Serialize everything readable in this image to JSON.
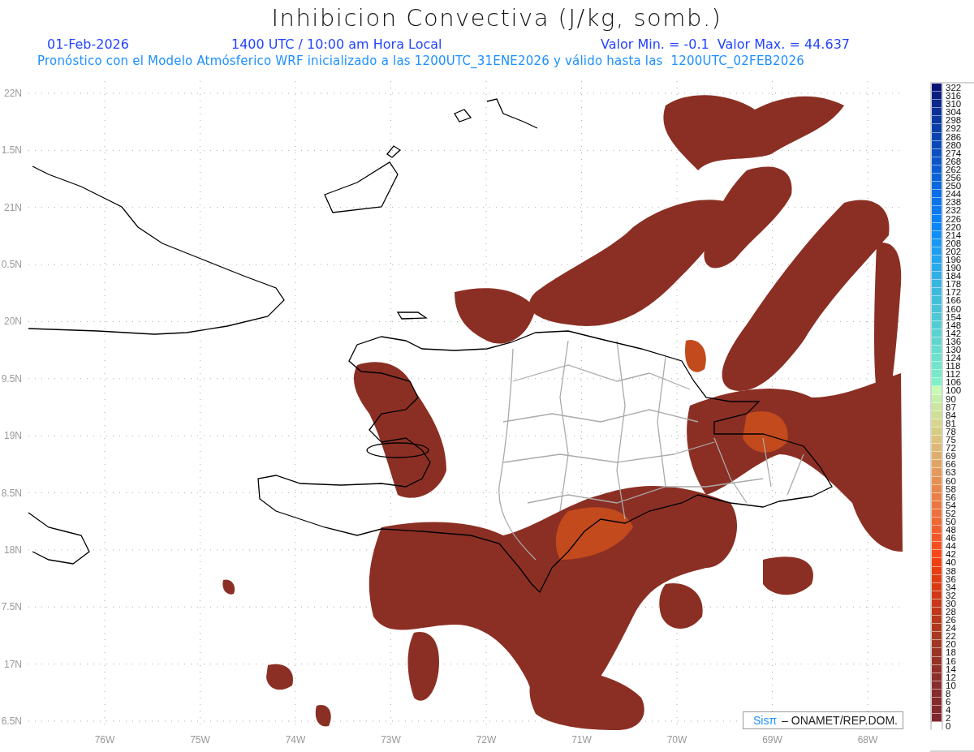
{
  "title": "Inhibicion Convectiva (J/kg, somb.)",
  "subtitle": {
    "date": "01-Feb-2026",
    "time": "1400 UTC / 10:00 am Hora Local",
    "range": "Valor Min. = -0.1  Valor Max. = 44.637"
  },
  "description": "Pronóstico con el Modelo Atmósferico WRF inicializado a las 1200UTC_31ENE2026 y válido hasta las  1200UTC_02FEB2026",
  "map": {
    "latitude_labels": [
      "22N",
      "1.5N",
      "21N",
      "0.5N",
      "20N",
      "9.5N",
      "19N",
      "8.5N",
      "18N",
      "7.5N",
      "17N",
      "6.5N"
    ],
    "longitude_labels": [
      "76W",
      "75W",
      "74W",
      "73W",
      "72W",
      "71W",
      "70W",
      "69W",
      "68W"
    ],
    "credit": {
      "brand": "Sisπ",
      "text": "– ONAMET/REP.DOM."
    }
  },
  "legend": {
    "levels": [
      {
        "label": "322",
        "color": "#0a1478"
      },
      {
        "label": "316",
        "color": "#0a1e82"
      },
      {
        "label": "310",
        "color": "#0a288c"
      },
      {
        "label": "304",
        "color": "#0a3096"
      },
      {
        "label": "298",
        "color": "#0a38a0"
      },
      {
        "label": "292",
        "color": "#0a3ea8"
      },
      {
        "label": "286",
        "color": "#0a44b0"
      },
      {
        "label": "280",
        "color": "#0a4ab8"
      },
      {
        "label": "274",
        "color": "#0a50c0"
      },
      {
        "label": "268",
        "color": "#0a56c8"
      },
      {
        "label": "262",
        "color": "#0a5cd0"
      },
      {
        "label": "256",
        "color": "#0a62d8"
      },
      {
        "label": "250",
        "color": "#0a68e0"
      },
      {
        "label": "244",
        "color": "#0a6ee6"
      },
      {
        "label": "238",
        "color": "#0a74ec"
      },
      {
        "label": "232",
        "color": "#0a7af0"
      },
      {
        "label": "226",
        "color": "#0a80f4"
      },
      {
        "label": "220",
        "color": "#0a86f6"
      },
      {
        "label": "214",
        "color": "#1090f6"
      },
      {
        "label": "208",
        "color": "#1898f2"
      },
      {
        "label": "202",
        "color": "#1e9ef0"
      },
      {
        "label": "196",
        "color": "#24a4ec"
      },
      {
        "label": "190",
        "color": "#2aaaea"
      },
      {
        "label": "184",
        "color": "#30b0e6"
      },
      {
        "label": "178",
        "color": "#36b6e2"
      },
      {
        "label": "172",
        "color": "#3cbade"
      },
      {
        "label": "166",
        "color": "#42c0da"
      },
      {
        "label": "160",
        "color": "#48c4d8"
      },
      {
        "label": "154",
        "color": "#4ec8d6"
      },
      {
        "label": "148",
        "color": "#54ccd4"
      },
      {
        "label": "142",
        "color": "#5ad2d2"
      },
      {
        "label": "136",
        "color": "#60d6d0"
      },
      {
        "label": "130",
        "color": "#66dcce"
      },
      {
        "label": "124",
        "color": "#6ce2cc"
      },
      {
        "label": "118",
        "color": "#72e6ca"
      },
      {
        "label": "112",
        "color": "#78eac8"
      },
      {
        "label": "106",
        "color": "#7ef0c8"
      },
      {
        "label": "100",
        "color": "#c8fab4"
      },
      {
        "label": "90",
        "color": "#c4f0a8"
      },
      {
        "label": "87",
        "color": "#cce6a0"
      },
      {
        "label": "84",
        "color": "#d0de96"
      },
      {
        "label": "81",
        "color": "#d6d68e"
      },
      {
        "label": "78",
        "color": "#d8cc84"
      },
      {
        "label": "75",
        "color": "#dcc27c"
      },
      {
        "label": "72",
        "color": "#deb874"
      },
      {
        "label": "69",
        "color": "#e0ae6c"
      },
      {
        "label": "66",
        "color": "#e2a464"
      },
      {
        "label": "63",
        "color": "#e49a5c"
      },
      {
        "label": "60",
        "color": "#e69052"
      },
      {
        "label": "58",
        "color": "#e8884c"
      },
      {
        "label": "56",
        "color": "#ea8046"
      },
      {
        "label": "54",
        "color": "#ec7840"
      },
      {
        "label": "52",
        "color": "#ee703a"
      },
      {
        "label": "50",
        "color": "#f06834"
      },
      {
        "label": "48",
        "color": "#f2602e"
      },
      {
        "label": "46",
        "color": "#f45828"
      },
      {
        "label": "44",
        "color": "#f65020"
      },
      {
        "label": "42",
        "color": "#f84818"
      },
      {
        "label": "40",
        "color": "#f04010"
      },
      {
        "label": "38",
        "color": "#e83e10"
      },
      {
        "label": "36",
        "color": "#e03c12"
      },
      {
        "label": "34",
        "color": "#d83a14"
      },
      {
        "label": "32",
        "color": "#d03816"
      },
      {
        "label": "30",
        "color": "#c83818"
      },
      {
        "label": "28",
        "color": "#c0381a"
      },
      {
        "label": "26",
        "color": "#b8381c"
      },
      {
        "label": "24",
        "color": "#b0381e"
      },
      {
        "label": "22",
        "color": "#a83820"
      },
      {
        "label": "20",
        "color": "#a03622"
      },
      {
        "label": "18",
        "color": "#9a3424"
      },
      {
        "label": "16",
        "color": "#963226"
      },
      {
        "label": "14",
        "color": "#923028"
      },
      {
        "label": "12",
        "color": "#8e2e2a"
      },
      {
        "label": "10",
        "color": "#8a2c2c"
      },
      {
        "label": "8",
        "color": "#882c2c"
      },
      {
        "label": "6",
        "color": "#862a2c"
      },
      {
        "label": "4",
        "color": "#84282c"
      },
      {
        "label": "2",
        "color": "#82262c"
      },
      {
        "label": "0",
        "color": "#ffffff"
      }
    ]
  }
}
